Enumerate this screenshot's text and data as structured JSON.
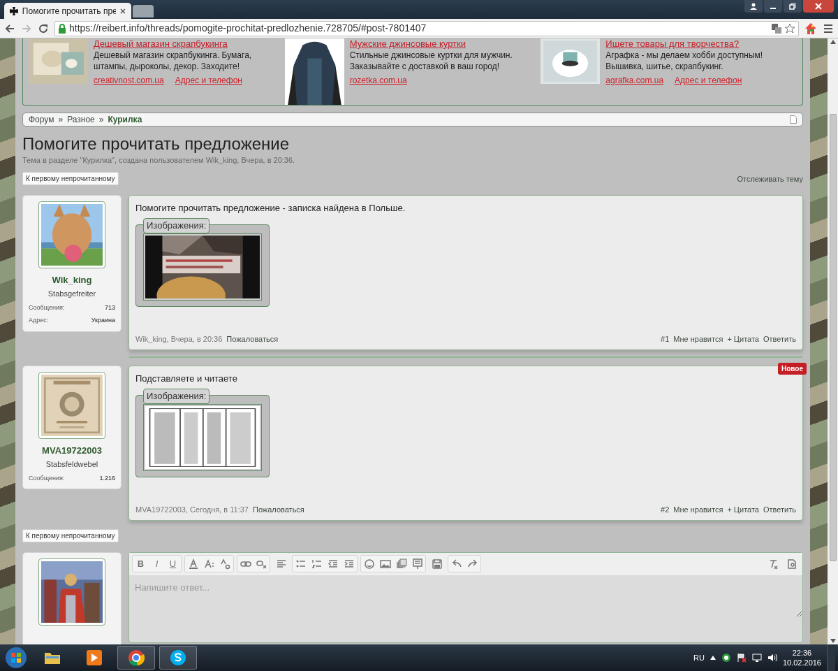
{
  "browser": {
    "tab_title": "Помогите прочитать пре",
    "url": "https://reibert.info/threads/pomogite-prochitat-predlozhenie.728705/#post-7801407"
  },
  "ads": [
    {
      "title": "Дешевый магазин скрапбукинга",
      "text": "Дешевый магазин скрапбукинга. Бумага, штампы, дыроколы, декор. Заходите!",
      "site": "creativnost.com.ua",
      "address": "Адрес и телефон",
      "image": {
        "kind": "picture"
      }
    },
    {
      "title": "Мужские джинсовые куртки",
      "text": "Стильные джинсовые куртки для мужчин. Заказывайте с доставкой в ваш город!",
      "site": "rozetka.com.ua",
      "image": {
        "kind": "picture"
      }
    },
    {
      "title": "Ищете товары для творчества?",
      "text": "Аграфка - мы делаем хобби доступным! Вышивка, шитье, скрапбукинг.",
      "site": "agrafka.com.ua",
      "address": "Адрес и телефон",
      "image": {
        "kind": "picture"
      }
    }
  ],
  "breadcrumb": {
    "separator": "»",
    "items": [
      {
        "label": "Форум",
        "current": false
      },
      {
        "label": "Разное",
        "current": false
      },
      {
        "label": "Курилка",
        "current": true
      }
    ]
  },
  "thread": {
    "title": "Помогите прочитать предложение",
    "meta": "Тема в разделе \"Курилка\", создана пользователем Wik_king, Вчера, в 20:36.",
    "unread_button": "К первому непрочитанному",
    "watch_link": "Отслеживать тему"
  },
  "posts": [
    {
      "author": "Wik_king",
      "rank": "Stabsgefreiter",
      "avatar": {
        "kind": "picture"
      },
      "stats": [
        {
          "label": "Сообщения:",
          "value": "713"
        },
        {
          "label": "Адрес:",
          "value": "Украина"
        }
      ],
      "text": "Помогите прочитать предложение - записка найдена в Польше.",
      "attachments_label": "Изображения:",
      "attachment": {
        "kind": "picture"
      },
      "byline": "Wik_king, Вчера, в 20:36",
      "report": "Пожаловаться",
      "number": "#1",
      "actions": [
        "Мне нравится",
        "+ Цитата",
        "Ответить"
      ]
    },
    {
      "author": "MVA19722003",
      "rank": "Stabsfeldwebel",
      "avatar": {
        "kind": "picture"
      },
      "stats": [
        {
          "label": "Сообщения:",
          "value": "1.216"
        }
      ],
      "text": "Подставляете и читаете",
      "attachments_label": "Изображения:",
      "attachment": {
        "kind": "picture"
      },
      "byline": "MVA19722003, Сегодня, в 11:37",
      "report": "Пожаловаться",
      "number": "#2",
      "actions": [
        "Мне нравится",
        "+ Цитата",
        "Ответить"
      ],
      "new_badge": "Новое"
    }
  ],
  "bottom_unread_button": "К первому непрочитанному",
  "editor": {
    "avatar": {
      "kind": "picture"
    },
    "format_letters": [
      "B",
      "I",
      "U"
    ],
    "placeholder": "Напишите ответ..."
  },
  "taskbar": {
    "language": "RU",
    "time": "22:36",
    "date": "10.02.2016"
  }
}
